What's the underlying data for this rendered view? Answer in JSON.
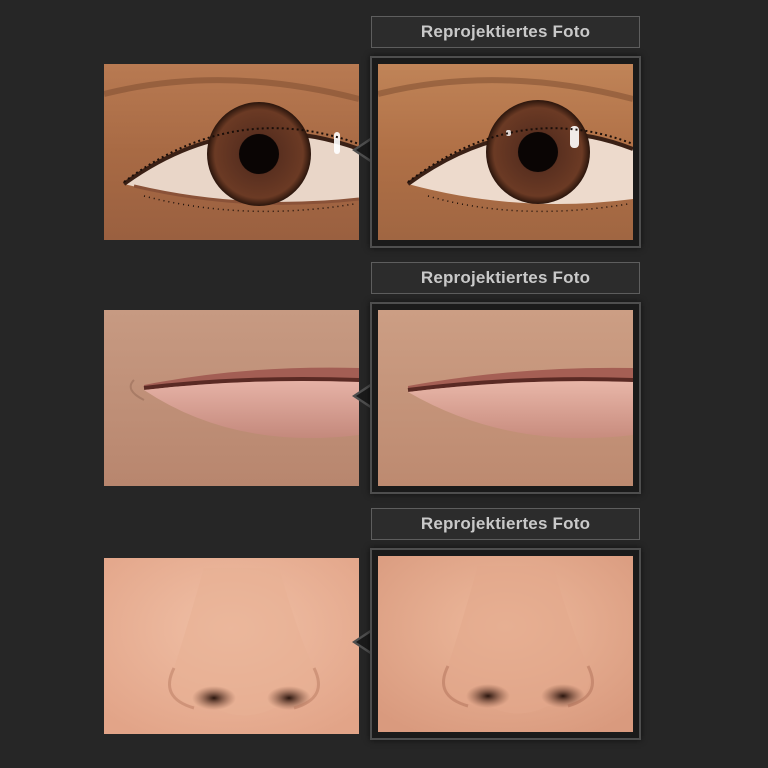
{
  "panels": [
    {
      "id": "eye",
      "label": "Reprojektiertes Foto",
      "subject": "eye-closeup"
    },
    {
      "id": "lips",
      "label": "Reprojektiertes Foto",
      "subject": "lips-closeup"
    },
    {
      "id": "nose",
      "label": "Reprojektiertes Foto",
      "subject": "nose-closeup"
    }
  ],
  "colors": {
    "background": "#262626",
    "label_text": "#c9c9c9",
    "frame_border": "#4e4e4e"
  }
}
